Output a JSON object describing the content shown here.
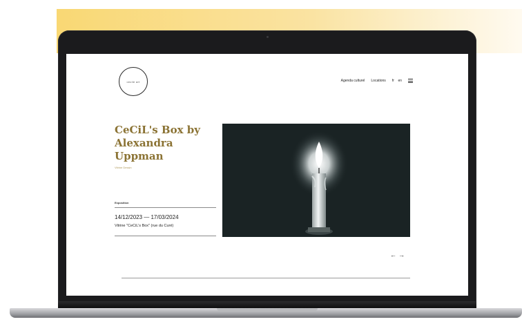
{
  "site": {
    "logo": {
      "text": "cecile art"
    },
    "nav": {
      "items": [
        "Agenda culturel",
        "Locations"
      ],
      "lang_fr": "fr",
      "lang_en": "en",
      "menu_icon": "hamburger-menu-icon"
    }
  },
  "event": {
    "title": "CeCiL's Box by Alexandra Uppman",
    "subtitle": "Vitrine Dessin",
    "section_label": "Exposition",
    "dates": "14/12/2023 — 17/03/2024",
    "venue": "Vitrine \"CeCiL's Box\" (rue du Curé)"
  },
  "carousel": {
    "prev_arrow": "←",
    "next_arrow": "→",
    "image_subject": "candle-drawing"
  },
  "colors": {
    "accent_gold": "#8b7334",
    "banner_yellow": "#f9d874",
    "laptop_bezel": "#1b1b1d"
  }
}
